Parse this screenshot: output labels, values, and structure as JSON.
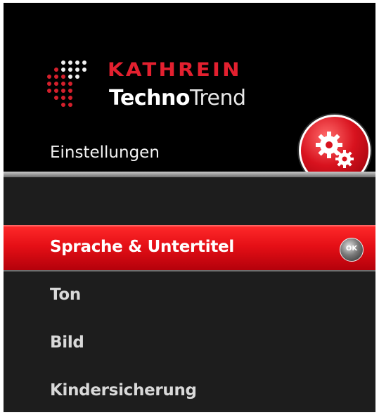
{
  "brand": {
    "name_top": "KATHREIN",
    "name_bottom_bold": "Techno",
    "name_bottom_light": "Trend",
    "accent_color": "#e3202f"
  },
  "header": {
    "title": "Einstellungen",
    "icon": "settings-gears-icon"
  },
  "menu": {
    "items": [
      {
        "label": "",
        "selected": false
      },
      {
        "label": "Sprache & Untertitel",
        "selected": true,
        "hint": "OK"
      },
      {
        "label": "Ton",
        "selected": false
      },
      {
        "label": "Bild",
        "selected": false
      },
      {
        "label": "Kindersicherung",
        "selected": false
      }
    ]
  }
}
